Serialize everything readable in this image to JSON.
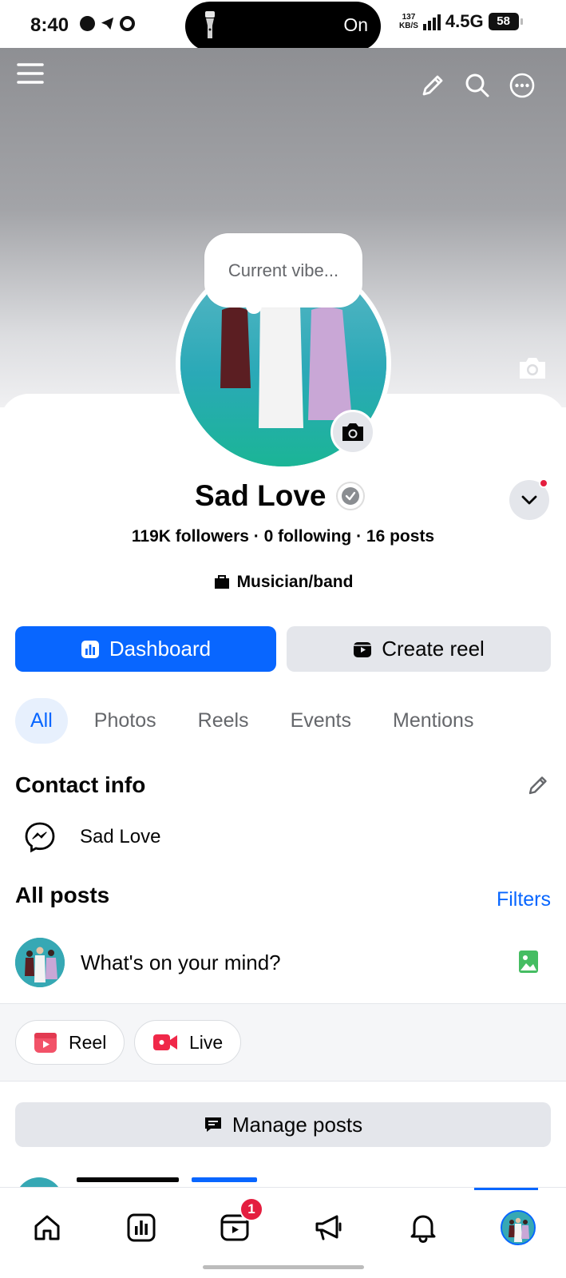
{
  "status_bar": {
    "time": "8:40",
    "pill_text": "On",
    "net_speed_value": "137",
    "net_speed_unit": "KB/S",
    "network": "4.5G",
    "battery": "58"
  },
  "profile": {
    "bubble_placeholder": "Current vibe...",
    "name": "Sad Love",
    "stats": "119K followers · 0 following · 16 posts",
    "category": "Musician/band"
  },
  "actions": {
    "dashboard_label": "Dashboard",
    "create_reel_label": "Create reel"
  },
  "tabs": [
    "All",
    "Photos",
    "Reels",
    "Events",
    "Mentions"
  ],
  "contact": {
    "title": "Contact info",
    "messenger_name": "Sad Love"
  },
  "posts": {
    "title": "All posts",
    "filters_label": "Filters",
    "composer_placeholder": "What's on your mind?",
    "chips": [
      "Reel",
      "Live"
    ],
    "manage_label": "Manage posts"
  },
  "nav": {
    "reels_badge": "1"
  },
  "colors": {
    "brand_blue": "#0866ff",
    "badge_red": "#e41e3f",
    "chip_gray": "#e4e6eb"
  },
  "icons": {
    "top_left": "menu-icon",
    "top_right": [
      "pencil-icon",
      "search-icon",
      "more-icon"
    ],
    "nav": [
      "home-icon",
      "dashboard-icon",
      "reels-icon",
      "megaphone-icon",
      "bell-icon",
      "profile-avatar"
    ]
  }
}
